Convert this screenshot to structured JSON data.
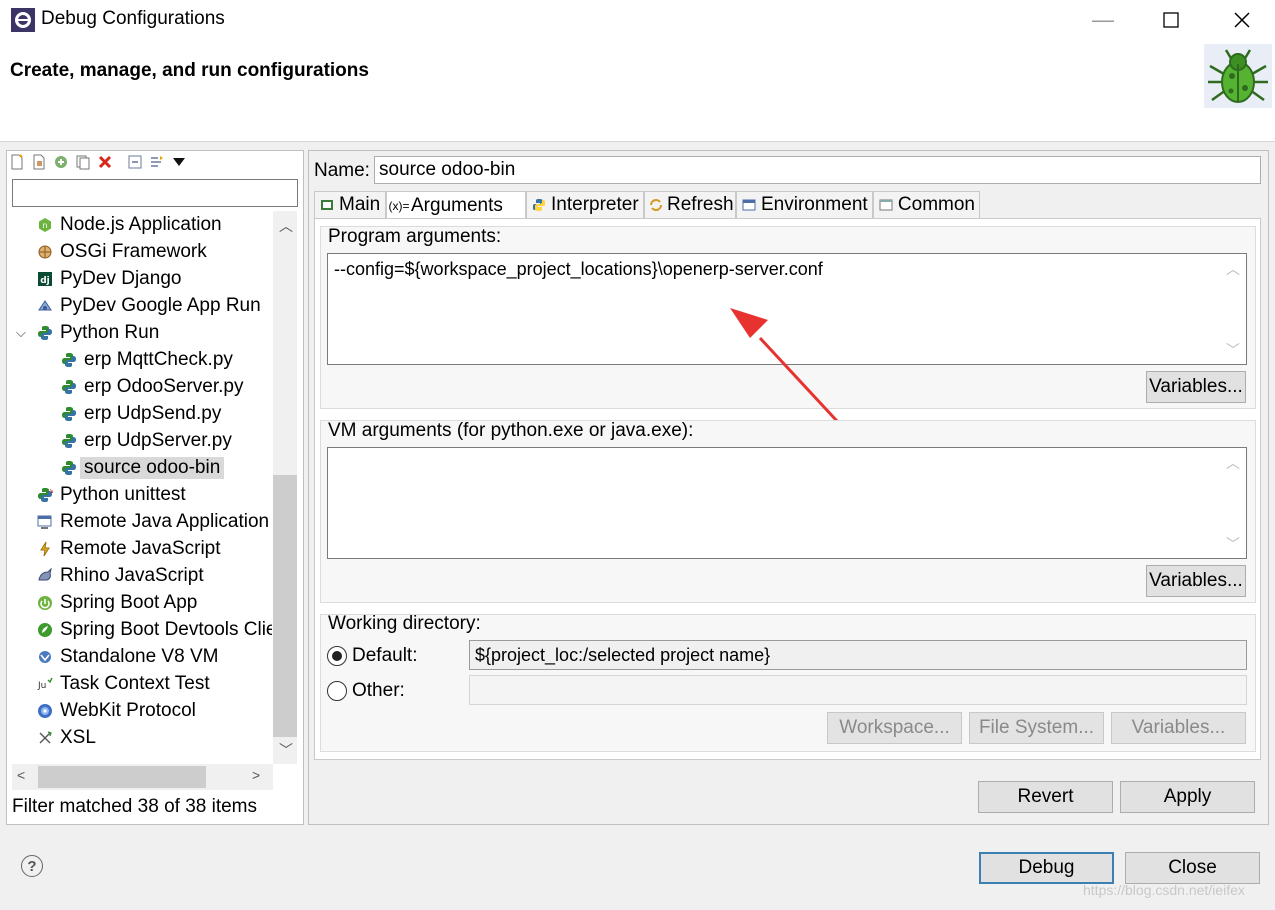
{
  "window": {
    "title": "Debug Configurations",
    "header_title": "Create, manage, and run configurations"
  },
  "left": {
    "filter_placeholder": "",
    "tree": [
      {
        "label": "Node.js Application",
        "icon": "nodejs-icon",
        "level": 0
      },
      {
        "label": "OSGi Framework",
        "icon": "osgi-icon",
        "level": 0
      },
      {
        "label": "PyDev Django",
        "icon": "django-icon",
        "level": 0
      },
      {
        "label": "PyDev Google App Run",
        "icon": "google-app-icon",
        "level": 0
      },
      {
        "label": "Python Run",
        "icon": "python-icon",
        "level": 0,
        "expanded": true
      },
      {
        "label": "erp MqttCheck.py",
        "icon": "python-icon",
        "level": 1
      },
      {
        "label": "erp OdooServer.py",
        "icon": "python-icon",
        "level": 1
      },
      {
        "label": "erp UdpSend.py",
        "icon": "python-icon",
        "level": 1
      },
      {
        "label": "erp UdpServer.py",
        "icon": "python-icon",
        "level": 1
      },
      {
        "label": "source odoo-bin",
        "icon": "python-icon",
        "level": 1,
        "selected": true
      },
      {
        "label": "Python unittest",
        "icon": "python-unittest-icon",
        "level": 0
      },
      {
        "label": "Remote Java Application",
        "icon": "remote-java-icon",
        "level": 0
      },
      {
        "label": "Remote JavaScript",
        "icon": "remote-js-icon",
        "level": 0
      },
      {
        "label": "Rhino JavaScript",
        "icon": "rhino-icon",
        "level": 0
      },
      {
        "label": "Spring Boot App",
        "icon": "spring-icon",
        "level": 0
      },
      {
        "label": "Spring Boot Devtools Client",
        "icon": "spring-devtools-icon",
        "level": 0
      },
      {
        "label": "Standalone V8 VM",
        "icon": "v8-icon",
        "level": 0
      },
      {
        "label": "Task Context Test",
        "icon": "junit-icon",
        "level": 0
      },
      {
        "label": "WebKit Protocol",
        "icon": "webkit-icon",
        "level": 0
      },
      {
        "label": "XSL",
        "icon": "xsl-icon",
        "level": 0
      }
    ],
    "filter_status": "Filter matched 38 of 38 items"
  },
  "right": {
    "name_label": "Name:",
    "name_value": "source odoo-bin",
    "tabs": [
      {
        "label": "Main",
        "icon": "main-tab-icon"
      },
      {
        "label": "Arguments",
        "icon": "arguments-tab-icon",
        "active": true
      },
      {
        "label": "Interpreter",
        "icon": "interpreter-tab-icon"
      },
      {
        "label": "Refresh",
        "icon": "refresh-tab-icon"
      },
      {
        "label": "Environment",
        "icon": "environment-tab-icon"
      },
      {
        "label": "Common",
        "icon": "common-tab-icon"
      }
    ],
    "program_args_label": "Program arguments:",
    "program_args_value": "--config=${workspace_project_locations}\\openerp-server.conf",
    "vm_args_label": "VM arguments (for python.exe or java.exe):",
    "vm_args_value": "",
    "variables_label": "Variables...",
    "working_dir_label": "Working directory:",
    "default_label": "Default:",
    "default_value": "${project_loc:/selected project name}",
    "other_label": "Other:",
    "other_value": "",
    "workspace_label": "Workspace...",
    "filesystem_label": "File System...",
    "revert_label": "Revert",
    "apply_label": "Apply"
  },
  "footer": {
    "debug_label": "Debug",
    "close_label": "Close",
    "watermark": "https://blog.csdn.net/ieifex"
  },
  "colors": {
    "annotation_arrow": "#e8322f",
    "primary_border": "#3c7fb1"
  }
}
